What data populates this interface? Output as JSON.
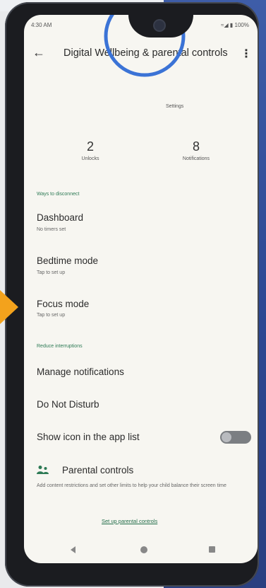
{
  "status": {
    "time": "4:30 AM",
    "right": "≈◢ ▮ 100%"
  },
  "appbar": {
    "back": "←",
    "title": "Digital Wellbeing & parental controls",
    "more": "⋮"
  },
  "dashboard_ring": {
    "label": "Settings"
  },
  "stats": [
    {
      "value": "2",
      "label": "Unlocks"
    },
    {
      "value": "8",
      "label": "Notifications"
    }
  ],
  "sections": {
    "disconnect": "Ways to disconnect",
    "interruptions": "Reduce interruptions"
  },
  "items": {
    "dashboard": {
      "title": "Dashboard",
      "subtitle": "No timers set"
    },
    "bedtime": {
      "title": "Bedtime mode",
      "subtitle": "Tap to set up"
    },
    "focus": {
      "title": "Focus mode",
      "subtitle": "Tap to set up"
    },
    "manage_notifications": {
      "title": "Manage notifications"
    },
    "dnd": {
      "title": "Do Not Disturb"
    },
    "show_icon": {
      "title": "Show icon in the app list",
      "enabled": false
    }
  },
  "parental": {
    "title": "Parental controls",
    "description": "Add content restrictions and set other limits to help your child balance their screen time",
    "link": "Set up parental controls"
  },
  "colors": {
    "accent_green": "#2d7a55",
    "ring_blue": "#3b73d6",
    "highlight_arrow": "#f3a21c"
  }
}
